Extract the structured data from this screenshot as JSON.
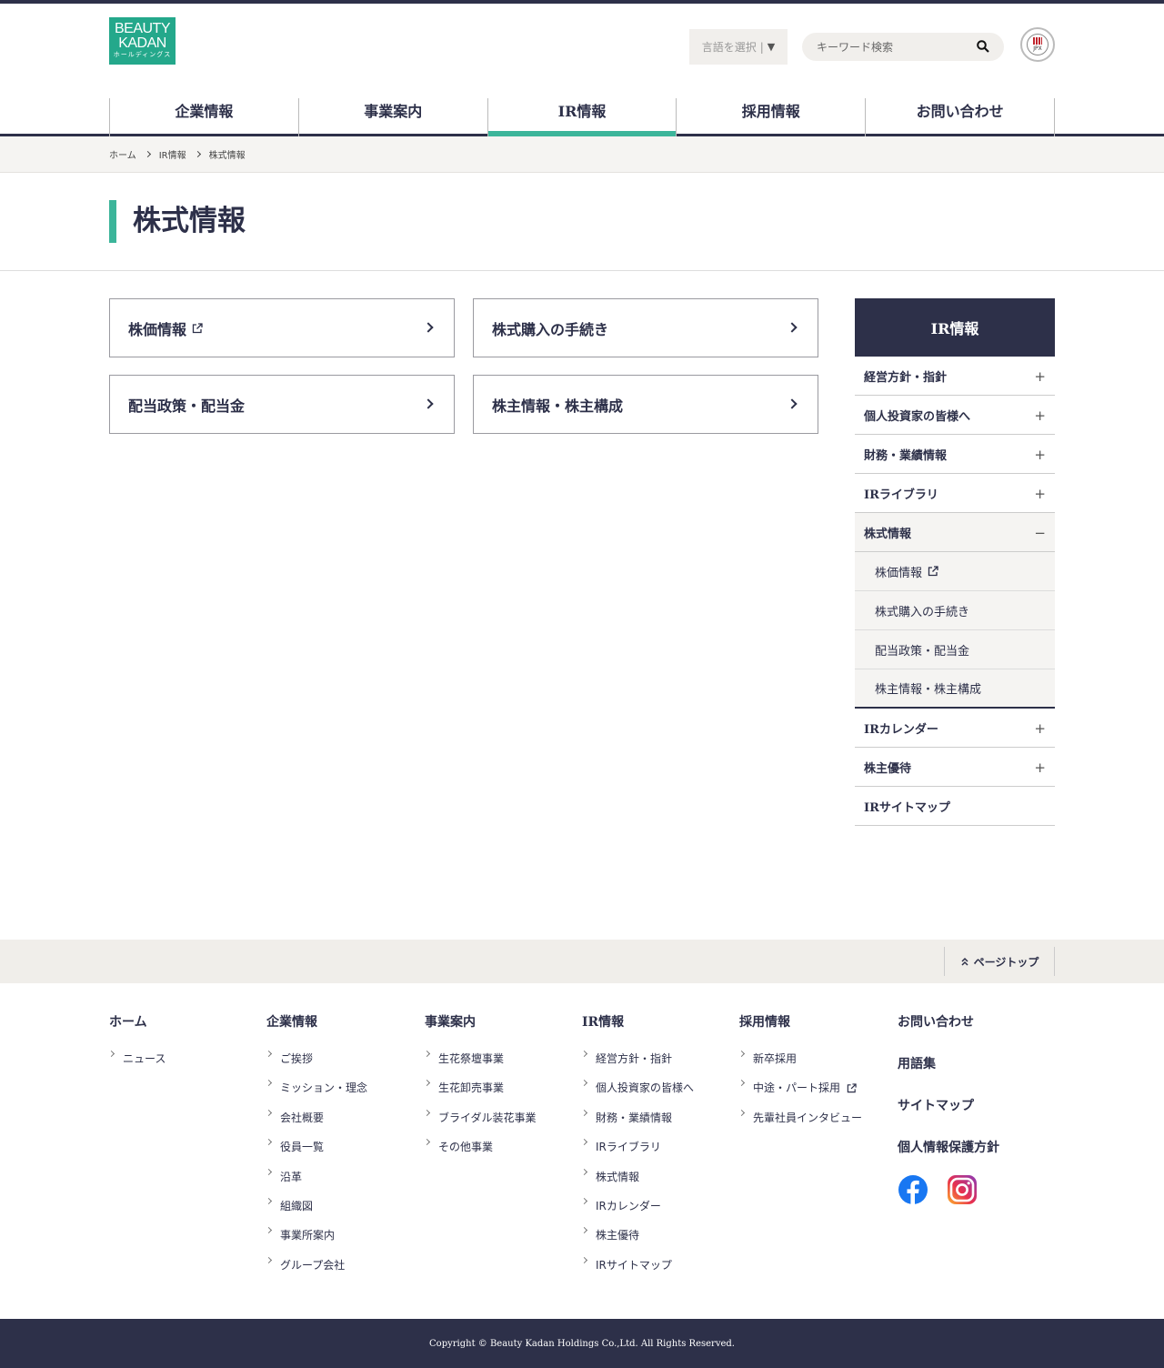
{
  "logo": {
    "line1": "BEAUTY",
    "line2": "KADAN",
    "line3": "ホールディングス"
  },
  "header": {
    "lang_label": "言語を選択",
    "lang_sep": "|",
    "lang_arrow": "▼",
    "search_placeholder": "キーワード検索",
    "badge_text": "JPX"
  },
  "gnav": [
    "企業情報",
    "事業案内",
    "IR情報",
    "採用情報",
    "お問い合わせ"
  ],
  "gnav_active": "IR情報",
  "breadcrumb": [
    "ホーム",
    "IR情報",
    "株式情報"
  ],
  "page_title": "株式情報",
  "cards": [
    "株価情報",
    "株式購入の手続き",
    "配当政策・配当金",
    "株主情報・株主構成"
  ],
  "sidebar": {
    "title": "IR情報",
    "items": [
      {
        "label": "経営方針・指針",
        "mark": "+"
      },
      {
        "label": "個人投資家の皆様へ",
        "mark": "+"
      },
      {
        "label": "財務・業績情報",
        "mark": "+"
      },
      {
        "label": "IRライブラリ",
        "mark": "+"
      },
      {
        "label": "株式情報",
        "mark": "−"
      }
    ],
    "sub": [
      "株価情報",
      "株式購入の手続き",
      "配当政策・配当金",
      "株主情報・株主構成"
    ],
    "items_after": [
      {
        "label": "IRカレンダー",
        "mark": "+"
      },
      {
        "label": "株主優待",
        "mark": "+"
      },
      {
        "label": "IRサイトマップ",
        "mark": ""
      }
    ]
  },
  "pagetop": "ページトップ",
  "footer": {
    "cols": [
      {
        "title": "ホーム",
        "links": [
          "ニュース"
        ]
      },
      {
        "title": "企業情報",
        "links": [
          "ご挨拶",
          "ミッション・理念",
          "会社概要",
          "役員一覧",
          "沿革",
          "組織図",
          "事業所案内",
          "グループ会社"
        ]
      },
      {
        "title": "事業案内",
        "links": [
          "生花祭壇事業",
          "生花卸売事業",
          "ブライダル装花事業",
          "その他事業"
        ]
      },
      {
        "title": "IR情報",
        "links": [
          "経営方針・指針",
          "個人投資家の皆様へ",
          "財務・業績情報",
          "IRライブラリ",
          "株式情報",
          "IRカレンダー",
          "株主優待",
          "IRサイトマップ"
        ]
      },
      {
        "title": "採用情報",
        "links": [
          "新卒採用",
          "中途・パート採用",
          "先輩社員インタビュー"
        ]
      }
    ],
    "right": [
      "お問い合わせ",
      "用語集",
      "サイトマップ",
      "個人情報保護方針"
    ],
    "copyright": "Copyright © Beauty Kadan Holdings Co.,Ltd. All Rights Reserved."
  },
  "colors": {
    "navy": "#2d3049",
    "accent": "#3cb59a",
    "logo": "#24a88b",
    "beige": "#f0eeea"
  }
}
